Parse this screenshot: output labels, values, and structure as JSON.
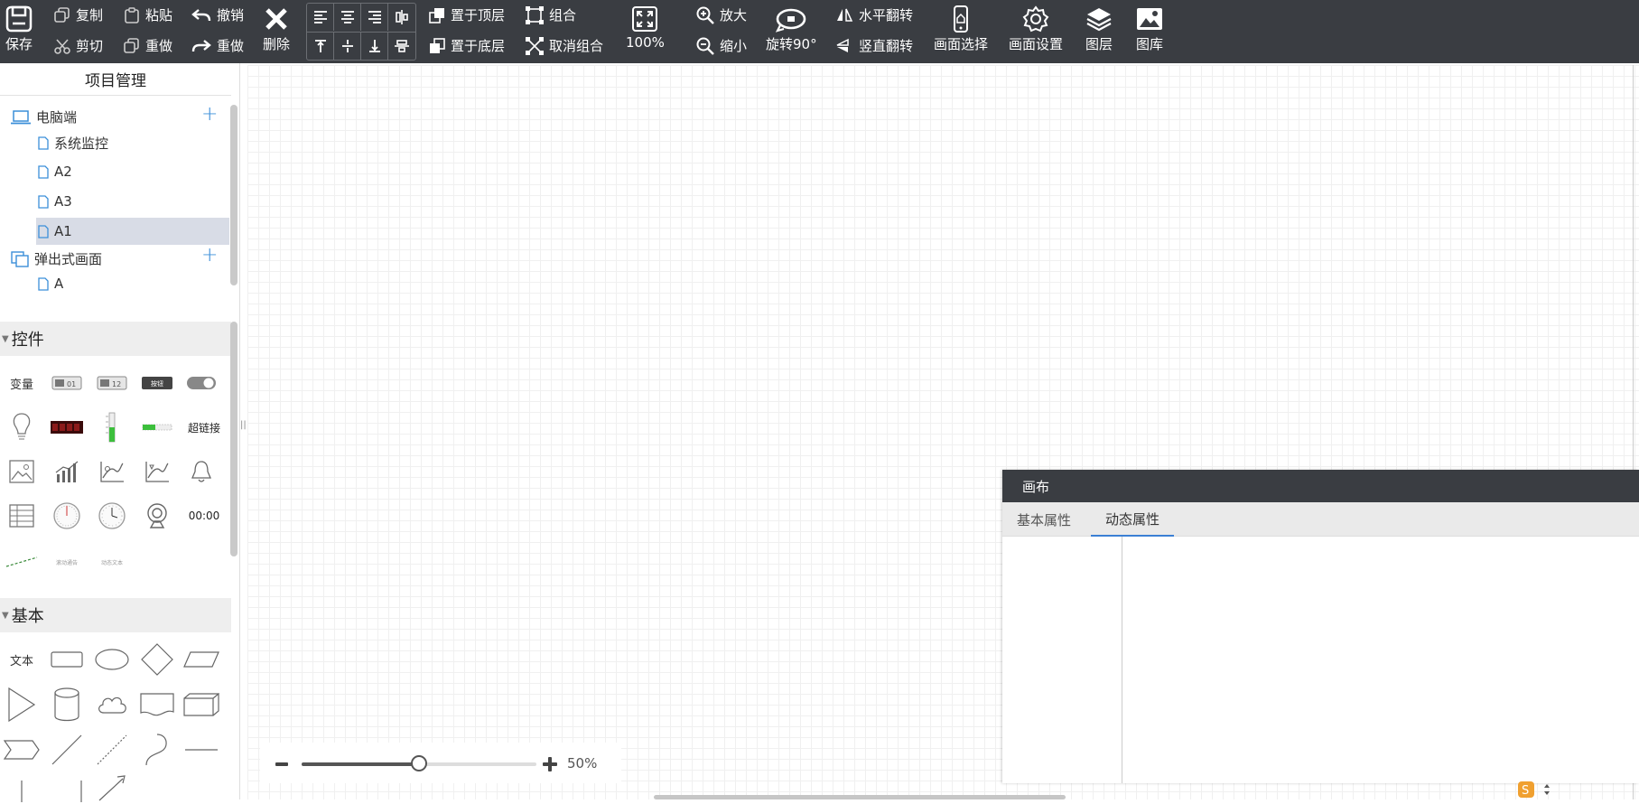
{
  "toolbar": {
    "save": "保存",
    "copy": "复制",
    "cut": "剪切",
    "paste": "粘贴",
    "redo": "重做",
    "undo": "撤销",
    "redo2": "重做",
    "delete": "删除",
    "bring_front": "置于顶层",
    "send_back": "置于底层",
    "group": "组合",
    "ungroup": "取消组合",
    "fit_zoom": "100%",
    "zoom_in": "放大",
    "zoom_out": "缩小",
    "rotate": "旋转90°",
    "flip_h": "水平翻转",
    "flip_v": "竖直翻转",
    "screen_select": "画面选择",
    "screen_settings": "画面设置",
    "layers": "图层",
    "gallery": "图库"
  },
  "project": {
    "title": "项目管理",
    "groups": [
      {
        "label": "电脑端",
        "items": [
          "系统监控",
          "A2",
          "A3",
          "A1"
        ],
        "selected": "A1"
      },
      {
        "label": "弹出式画面",
        "items": [
          "A"
        ]
      }
    ]
  },
  "controls": {
    "title": "控件",
    "variable": "变量",
    "hyperlink": "超链接",
    "clock": "00:00",
    "button_label": "按钮",
    "mini_text_1": "滚动通告",
    "mini_text_2": "动态文本"
  },
  "basic": {
    "title": "基本",
    "text": "文本"
  },
  "zoom": {
    "value_label": "50%",
    "level": 0.5
  },
  "dialog": {
    "title": "画布",
    "tabs": [
      "基本属性",
      "动态属性"
    ],
    "active_tab": 1
  },
  "colors": {
    "toolbar_bg": "#3a3d42",
    "accent": "#3b8fd9",
    "selected_row": "#d8dce6"
  }
}
